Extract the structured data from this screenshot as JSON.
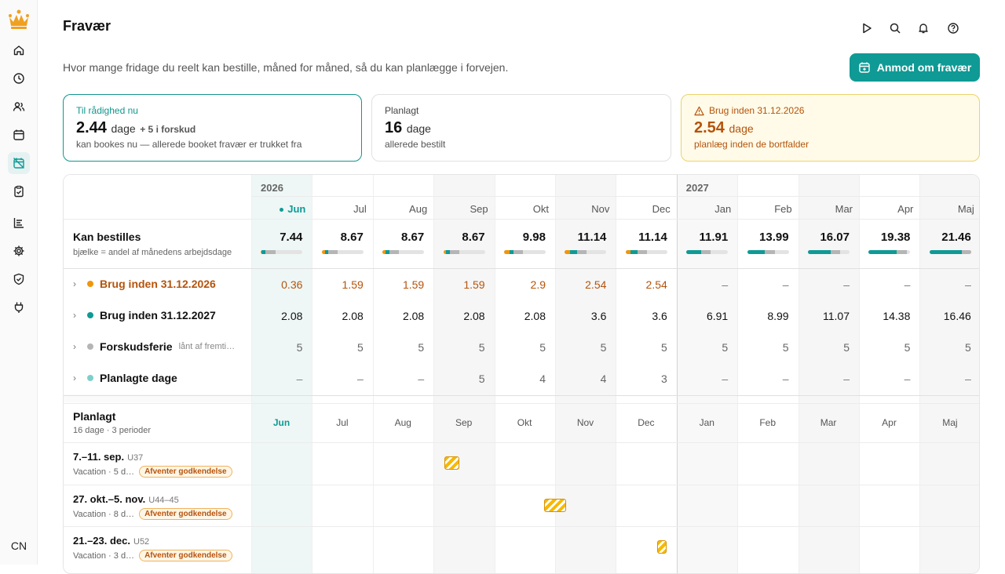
{
  "app": {
    "title": "Fravær",
    "subtitle": "Hvor mange fridage du reelt kan bestille, måned for måned, så du kan planlægge i forvejen."
  },
  "actions": {
    "request_label": "Anmod om fravær"
  },
  "sidebar": {
    "icons": [
      "home-icon",
      "clock-icon",
      "people-icon",
      "calendar-icon",
      "calendar-off-icon",
      "clipboard-check-icon",
      "report-icon",
      "gear-icon",
      "shield-check-icon",
      "plug-icon"
    ],
    "active_index": 4,
    "avatar": "CN"
  },
  "top_icons": [
    "play-icon",
    "search-icon",
    "bell-icon",
    "help-icon"
  ],
  "cards": {
    "available": {
      "label": "Til rådighed nu",
      "value": "2.44",
      "unit": "dage",
      "extra": "+ 5 i forskud",
      "desc": "kan bookes nu — allerede booket fravær er trukket fra"
    },
    "planned": {
      "label": "Planlagt",
      "value": "16",
      "unit": "dage",
      "desc": "allerede bestilt"
    },
    "expiring": {
      "label": "Brug inden 31.12.2026",
      "value": "2.54",
      "unit": "dage",
      "desc": "planlæg inden de bortfalder"
    }
  },
  "colors": {
    "accent": "#0f9a95",
    "orange": "#f0960a",
    "gray": "#b5b5b5",
    "lightteal": "#7fcfc9",
    "warn": "#b5530c"
  },
  "table": {
    "years": [
      "2026",
      "2027"
    ],
    "months": [
      "Jun",
      "Jul",
      "Aug",
      "Sep",
      "Okt",
      "Nov",
      "Dec",
      "Jan",
      "Feb",
      "Mar",
      "Apr",
      "Maj"
    ],
    "bookable": {
      "label": "Kan bestilles",
      "sub": "bjælke = andel af månedens arbejdsdage",
      "values": [
        "7.44",
        "8.67",
        "8.67",
        "8.67",
        "9.98",
        "11.14",
        "11.14",
        "11.91",
        "13.99",
        "16.07",
        "19.38",
        "21.46"
      ],
      "bars": [
        {
          "orange": 0.02,
          "teal": 0.09,
          "gray": 0.24
        },
        {
          "orange": 0.07,
          "teal": 0.09,
          "gray": 0.23
        },
        {
          "orange": 0.07,
          "teal": 0.09,
          "gray": 0.23
        },
        {
          "orange": 0.07,
          "teal": 0.09,
          "gray": 0.23
        },
        {
          "orange": 0.13,
          "teal": 0.09,
          "gray": 0.23
        },
        {
          "orange": 0.12,
          "teal": 0.17,
          "gray": 0.23
        },
        {
          "orange": 0.12,
          "teal": 0.17,
          "gray": 0.23
        },
        {
          "orange": 0,
          "teal": 0.35,
          "gray": 0.23
        },
        {
          "orange": 0,
          "teal": 0.43,
          "gray": 0.23
        },
        {
          "orange": 0,
          "teal": 0.55,
          "gray": 0.23
        },
        {
          "orange": 0,
          "teal": 0.68,
          "gray": 0.23
        },
        {
          "orange": 0,
          "teal": 0.77,
          "gray": 0.23
        }
      ]
    },
    "rows": [
      {
        "label": "Brug inden 31.12.2026",
        "note": "",
        "color": "#f0960a",
        "text_color": "#b5530c",
        "values": [
          "0.36",
          "1.59",
          "1.59",
          "1.59",
          "2.9",
          "2.54",
          "2.54",
          "–",
          "–",
          "–",
          "–",
          "–"
        ]
      },
      {
        "label": "Brug inden 31.12.2027",
        "note": "",
        "color": "#0f9a95",
        "text_color": "#111",
        "values": [
          "2.08",
          "2.08",
          "2.08",
          "2.08",
          "2.08",
          "3.6",
          "3.6",
          "6.91",
          "8.99",
          "11.07",
          "14.38",
          "16.46"
        ]
      },
      {
        "label": "Forskudsferie",
        "note": "lånt af fremti…",
        "color": "#b5b5b5",
        "text_color": "#666",
        "values": [
          "5",
          "5",
          "5",
          "5",
          "5",
          "5",
          "5",
          "5",
          "5",
          "5",
          "5",
          "5"
        ]
      },
      {
        "label": "Planlagte dage",
        "note": "",
        "color": "#7fcfc9",
        "text_color": "#666",
        "values": [
          "–",
          "–",
          "–",
          "5",
          "4",
          "4",
          "3",
          "–",
          "–",
          "–",
          "–",
          "–"
        ]
      }
    ],
    "planned": {
      "title": "Planlagt",
      "sub": "16 dage · 3 perioder",
      "periods": [
        {
          "title": "7.–11. sep.",
          "week": "U37",
          "type": "Vacation · 5 d…",
          "status": "Afventer godkendelse",
          "month_index": 3,
          "offset": 0.18,
          "span": 0.25
        },
        {
          "title": "27. okt.–5. nov.",
          "week": "U44–45",
          "type": "Vacation · 8 d…",
          "status": "Afventer godkendelse",
          "month_index": 4,
          "offset": 0.82,
          "span": 0.36
        },
        {
          "title": "21.–23. dec.",
          "week": "U52",
          "type": "Vacation · 3 d…",
          "status": "Afventer godkendelse",
          "month_index": 6,
          "offset": 0.68,
          "span": 0.16
        }
      ]
    }
  }
}
